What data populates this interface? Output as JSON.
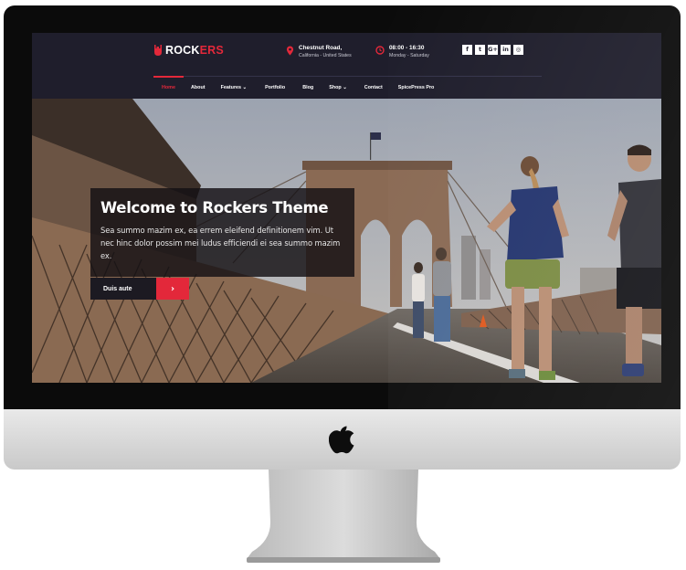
{
  "site": {
    "logo": {
      "prefix": "ROCK",
      "suffix": "ERS"
    },
    "address": {
      "line1": "Chestnut Road,",
      "line2": "California - United States"
    },
    "hours": {
      "line1": "08:00 - 16:30",
      "line2": "Monday - Saturday"
    },
    "social": [
      {
        "name": "facebook-icon",
        "glyph": "f"
      },
      {
        "name": "twitter-icon",
        "glyph": "t"
      },
      {
        "name": "google-plus-icon",
        "glyph": "G+"
      },
      {
        "name": "linkedin-icon",
        "glyph": "in"
      },
      {
        "name": "instagram-icon",
        "glyph": "◎"
      }
    ],
    "nav": [
      {
        "label": "Home",
        "active": true
      },
      {
        "label": "About"
      },
      {
        "label": "Features ⌄"
      },
      {
        "label": "Portfolio"
      },
      {
        "label": "Blog"
      },
      {
        "label": "Shop ⌄"
      },
      {
        "label": "Contact"
      },
      {
        "label": "SpicePress Pro"
      }
    ]
  },
  "hero": {
    "title": "Welcome to Rockers Theme",
    "text": "Sea summo mazim ex, ea errem eleifend definitionem vim. Ut nec hinc dolor possim mei ludus efficiendi ei sea summo mazim ex.",
    "button_label": "Duis aute",
    "button_arrow": "›"
  },
  "colors": {
    "accent": "#e3283a",
    "header_bg": "#1f1e2c",
    "bezel": "#0b0b0b"
  }
}
